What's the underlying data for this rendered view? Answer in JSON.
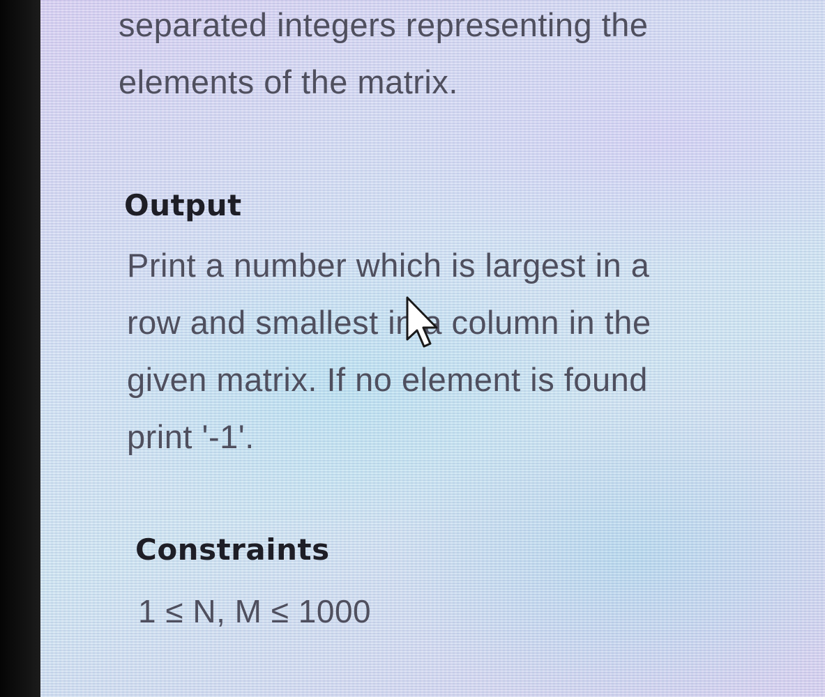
{
  "intro": {
    "lines": [
      "separated integers representing the",
      "elements of the matrix."
    ]
  },
  "output": {
    "heading": "Output",
    "lines": [
      "Print a number which is largest in a",
      "row and smallest in a column in the",
      "given matrix. If no element is found",
      "print '-1'."
    ]
  },
  "constraints": {
    "heading": "Constraints",
    "text": "1 ≤ N, M ≤ 1000"
  },
  "cursor": {
    "icon": "arrow-pointer-icon"
  }
}
